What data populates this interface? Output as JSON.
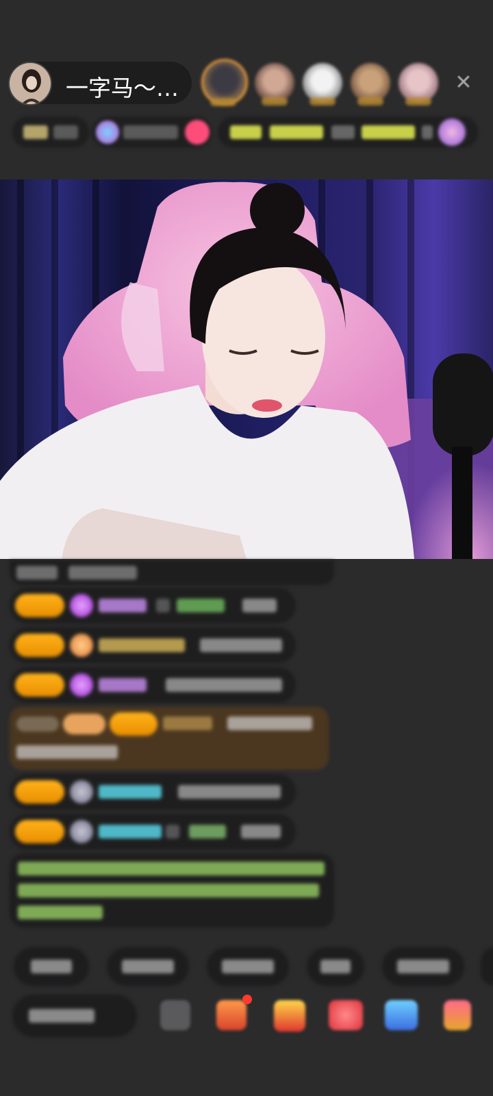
{
  "header": {
    "host_name": "一字马～…",
    "close_icon": "close-icon",
    "viewer_avatars": [
      "top-viewer-1",
      "top-viewer-2",
      "top-viewer-3",
      "top-viewer-4",
      "top-viewer-5"
    ]
  },
  "info_strip": {
    "items": [
      "hour-rank-chip",
      "popularity-chip",
      "activity-banner",
      "gift-chip"
    ]
  },
  "chat": {
    "messages": [
      {
        "kind": "system"
      },
      {
        "kind": "user",
        "badge_color": "#f0a010"
      },
      {
        "kind": "user",
        "badge_color": "#f0a010"
      },
      {
        "kind": "user",
        "badge_color": "#f0a010"
      },
      {
        "kind": "highlight"
      },
      {
        "kind": "user",
        "badge_color": "#f0a010"
      },
      {
        "kind": "user",
        "badge_color": "#f0a010"
      },
      {
        "kind": "notice",
        "text_color": "#9ec46a"
      }
    ]
  },
  "quick_replies": {
    "items": [
      "quick-reply-1",
      "quick-reply-2",
      "quick-reply-3",
      "quick-reply-4",
      "quick-reply-5"
    ]
  },
  "bottom_bar": {
    "input_placeholder": "",
    "icons": [
      "emoji-icon",
      "gift-box-icon",
      "treasure-icon",
      "red-packet-icon",
      "game-icon",
      "more-gift-icon"
    ]
  },
  "colors": {
    "background": "#2b2b2c",
    "pill": "#1d1d1e",
    "badge": "#f0a010",
    "highlight_bg": "#4b3720",
    "green_text": "#9ec46a",
    "cyan_name": "#4fb8c8",
    "purple_name": "#b48ad6"
  }
}
